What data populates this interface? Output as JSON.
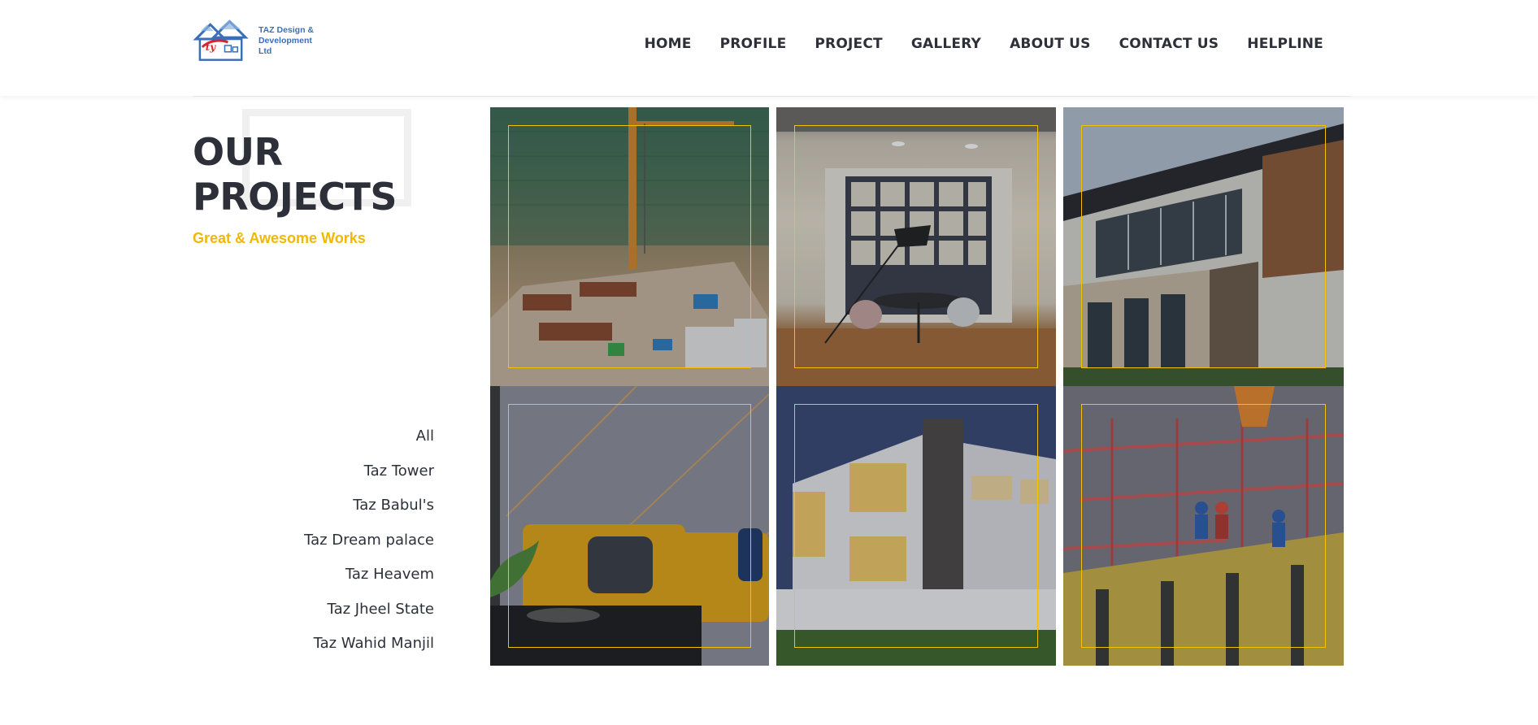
{
  "brand": {
    "line1": "TAZ Design &",
    "line2": "Development Ltd",
    "logo_icon": "house-logo-icon",
    "colors": {
      "blue": "#3a6fb8",
      "red": "#d9262c"
    }
  },
  "nav": {
    "items": [
      "HOME",
      "PROFILE",
      "PROJECT",
      "GALLERY",
      "ABOUT US",
      "CONTACT US",
      "HELPLINE"
    ]
  },
  "section": {
    "title_line1": "OUR",
    "title_line2": "PROJECTS",
    "subtitle": "Great & Awesome Works"
  },
  "filters": {
    "items": [
      "All",
      "Taz Tower",
      "Taz Babul's",
      "Taz Dream palace",
      "Taz Heavem",
      "Taz Jheel State",
      "Taz Wahid Manjil"
    ]
  },
  "gallery": {
    "tiles": [
      {
        "subject": "construction-site-crane"
      },
      {
        "subject": "interior-meeting-room"
      },
      {
        "subject": "building-facade"
      },
      {
        "subject": "yellow-chair-interior"
      },
      {
        "subject": "modern-house-dusk"
      },
      {
        "subject": "construction-workers-formwork"
      }
    ]
  },
  "colors": {
    "accent": "#f2b705",
    "frame": "#f2c200",
    "text": "#2d3038"
  }
}
